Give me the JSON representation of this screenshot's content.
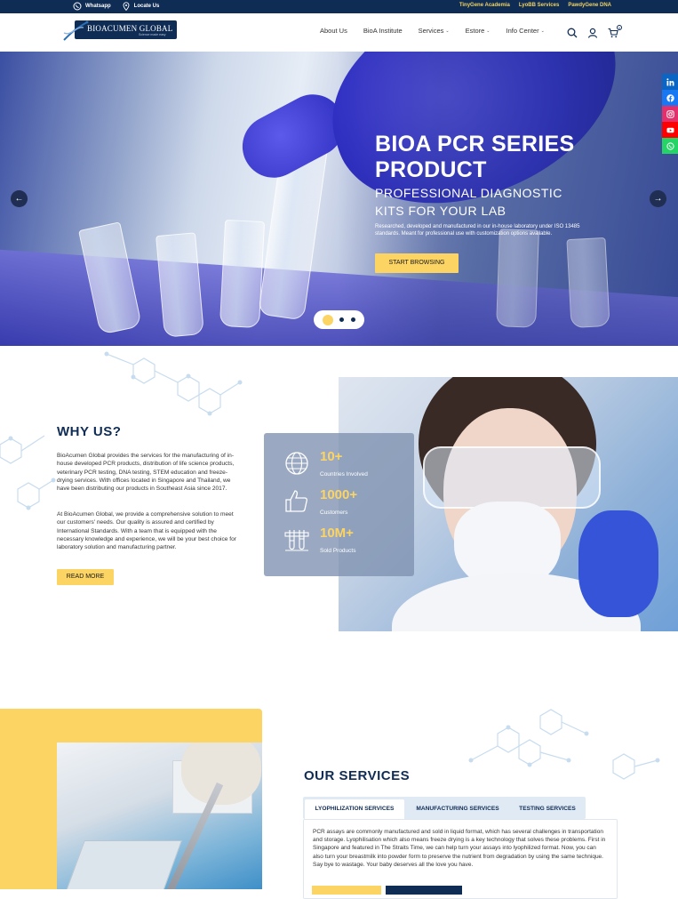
{
  "topbar": {
    "left": [
      {
        "label": "Whatsapp",
        "icon": "whatsapp-icon"
      },
      {
        "label": "Locate Us",
        "icon": "map-pin-icon"
      }
    ],
    "right": [
      "TinyGene Academia",
      "LyoBB Services",
      "PawdyGene DNA"
    ],
    "accent": "#f2d25c"
  },
  "header": {
    "logo_text": "BIOACUMEN GLOBAL",
    "logo_tagline": "Science made easy",
    "nav": [
      {
        "label": "About Us",
        "dropdown": false
      },
      {
        "label": "BioA Institute",
        "dropdown": false
      },
      {
        "label": "Services",
        "dropdown": true
      },
      {
        "label": "Estore",
        "dropdown": true
      },
      {
        "label": "Info Center",
        "dropdown": true
      }
    ],
    "cart_count": "0"
  },
  "hero": {
    "title": "BIOA PCR SERIES PRODUCT",
    "subtitle": "PROFESSIONAL DIAGNOSTIC KITS FOR YOUR LAB",
    "description": "Researched, developed and manufactured in our in-house laboratory under ISO 13485 standards. Meant for professional use with customization options available.",
    "cta": "START BROWSING",
    "slides": 3,
    "active_slide": 1
  },
  "social": [
    {
      "icon": "linkedin-icon",
      "color": "#0a66c2"
    },
    {
      "icon": "facebook-icon",
      "color": "#1877f2"
    },
    {
      "icon": "instagram-icon",
      "color": "#e1306c"
    },
    {
      "icon": "youtube-icon",
      "color": "#ff0000"
    },
    {
      "icon": "whatsapp-icon",
      "color": "#25d366"
    }
  ],
  "why": {
    "title": "WHY US?",
    "p1": "BioAcumen Global provides the services for the manufacturing of in-house developed PCR products, distribution of life science products, veterinary PCR testing, DNA testing, STEM education and freeze-drying services. With offices located in Singapore and Thailand, we have been distributing our products in Southeast Asia since 2017.",
    "p2": "At BioAcumen Global, we provide a comprehensive solution to meet our customers' needs. Our quality is assured and certified by International Standards. With a team that is equipped with the necessary knowledge and experience, we will be your best choice for laboratory solution and manufacturing partner.",
    "cta": "READ MORE"
  },
  "stats": [
    {
      "value": "10+",
      "label": "Countries Involved",
      "icon": "globe-icon"
    },
    {
      "value": "1000+",
      "label": "Customers",
      "icon": "thumbs-up-icon"
    },
    {
      "value": "10M+",
      "label": "Sold Products",
      "icon": "test-tubes-icon"
    }
  ],
  "services": {
    "title": "OUR SERVICES",
    "tabs": [
      "LYOPHILIZATION SERVICES",
      "MANUFACTURING SERVICES",
      "TESTING SERVICES"
    ],
    "active_tab": 0,
    "body": "PCR assays are commonly manufactured and sold in liquid format, which has several challenges in transportation and storage. Lyophilisation which also means freeze drying is a key technology that solves these problems. First in Singapore and featured in The Straits Time, we can help turn your assays into lyophilized format. Now, you can also turn your breastmilk into powder form to preserve the nutrient from degradation by using the same technique. Say bye to wastage. Your baby deserves all the love you have."
  },
  "colors": {
    "navy": "#0f2c55",
    "yellow": "#fcd464"
  }
}
